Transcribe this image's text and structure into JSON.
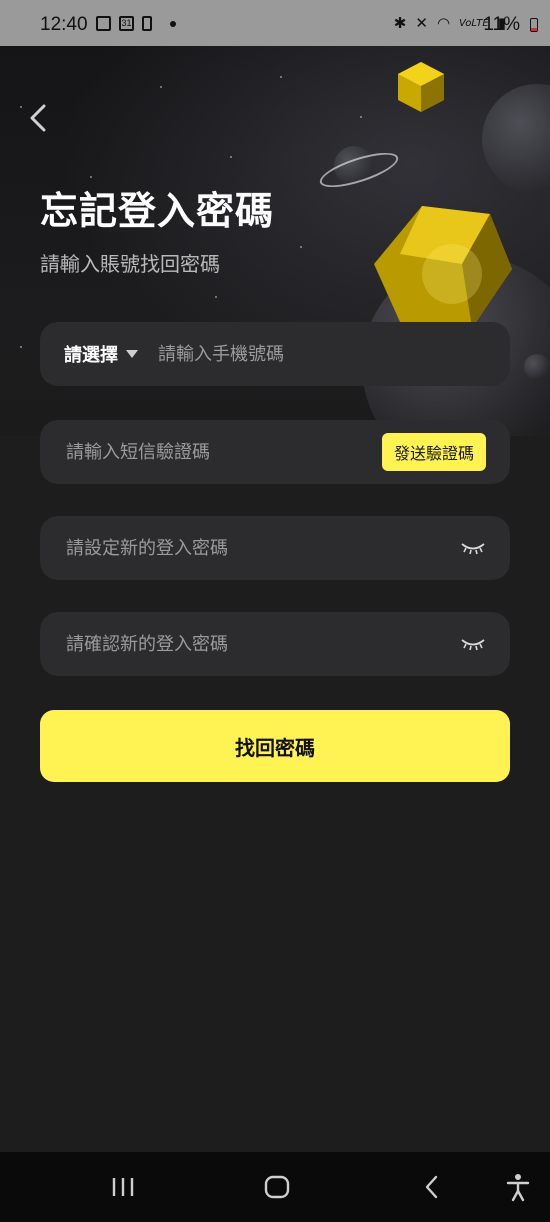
{
  "status_bar": {
    "time": "12:40",
    "calendar_day": "31",
    "network": "VoLTE",
    "battery": "11%"
  },
  "page": {
    "title": "忘記登入密碼",
    "subtitle": "請輸入賬號找回密碼"
  },
  "form": {
    "country_select_label": "請選擇",
    "phone_placeholder": "請輸入手機號碼",
    "sms_code_placeholder": "請輸入短信驗證碼",
    "send_code_label": "發送驗證碼",
    "new_password_placeholder": "請設定新的登入密碼",
    "confirm_password_placeholder": "請確認新的登入密碼",
    "submit_label": "找回密碼"
  },
  "colors": {
    "accent": "#fff253",
    "background": "#1b1b1c",
    "field": "#2c2c2e"
  },
  "icons": {
    "back": "chevron-left-icon",
    "eye_closed": "eye-closed-icon",
    "dropdown": "caret-down-icon"
  }
}
